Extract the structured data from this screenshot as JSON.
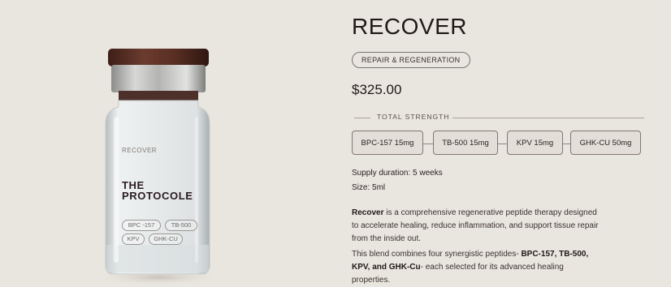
{
  "product": {
    "title": "RECOVER",
    "category_badge": "REPAIR & REGENERATION",
    "price": "$325.00",
    "strength_label": "TOTAL STRENGTH",
    "peptides": [
      "BPC-157 15mg",
      "TB-500 15mg",
      "KPV 15mg",
      "GHK-CU 50mg"
    ],
    "supply": "Supply duration: 5 weeks",
    "size": "Size: 5ml",
    "description_1": {
      "bold": "Recover",
      "text": " is a comprehensive regenerative peptide therapy designed to accelerate healing, reduce inflammation, and support tissue repair from the inside out."
    },
    "description_2": {
      "text_a": "This blend combines four synergistic peptides- ",
      "bold": "BPC-157, TB-500, KPV, and GHK-Cu",
      "text_b": "- each selected for its advanced healing properties."
    }
  },
  "vial": {
    "label": "RECOVER",
    "brand_line1": "THE",
    "brand_line2": "PROTOCOLE",
    "chips": [
      "BPC -157",
      "TB-500",
      "KPV",
      "GHK-CU"
    ],
    "cap_color": "#5b3328"
  },
  "colors": {
    "background": "#e9e5df",
    "text": "#2b2421",
    "peptide_fill": "#e3ded8"
  }
}
